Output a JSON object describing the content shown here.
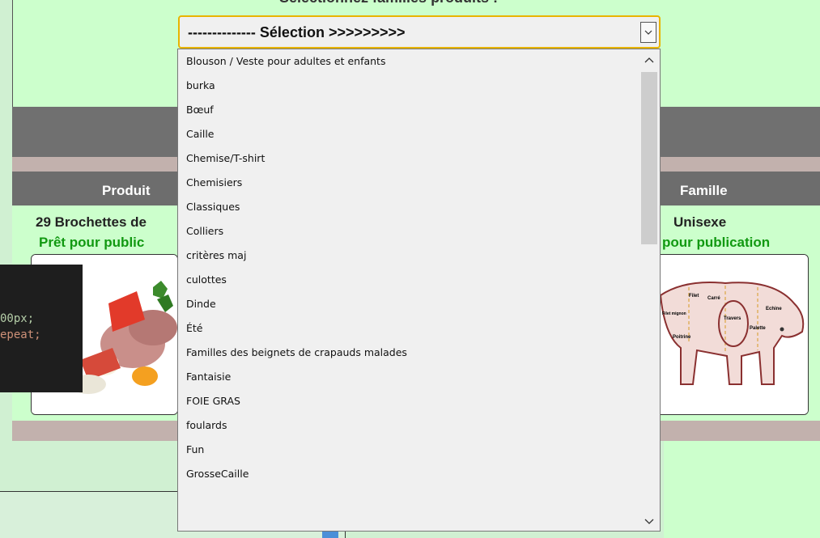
{
  "page": {
    "top_caption": "Sélectionnez familles produits :"
  },
  "select": {
    "value": "-------------- Sélection >>>>>>>>>"
  },
  "dropdown": {
    "items": [
      "Blouson / Veste pour adultes et enfants",
      "burka",
      "Bœuf",
      "Caille",
      "Chemise/T-shirt",
      "Chemisiers",
      "Classiques",
      "Colliers",
      "critères maj",
      "culottes",
      "Dinde",
      "Été",
      "Familles des beignets de crapauds malades",
      "Fantaisie",
      "FOIE GRAS",
      "foulards",
      "Fun",
      "GrosseCaille"
    ]
  },
  "table": {
    "header_product": "Produit",
    "header_family": "Famille",
    "product_name": "29 Brochettes de",
    "product_status": "Prêt pour public",
    "family_name": "Unisexe",
    "family_status": "pour publication"
  },
  "code_panel": {
    "line1": "00px;",
    "line2": "epeat;"
  },
  "pig_chart": {
    "labels": [
      "Filet",
      "Carré",
      "Echine",
      "Filet mignon",
      "Travers",
      "Palette",
      "Poitrine"
    ]
  },
  "colors": {
    "page_bg": "#ccffcc",
    "header_bg": "#6d6d6d",
    "status_green": "#119911",
    "select_border": "#e8b400",
    "code_bg": "#1e1e1e"
  }
}
